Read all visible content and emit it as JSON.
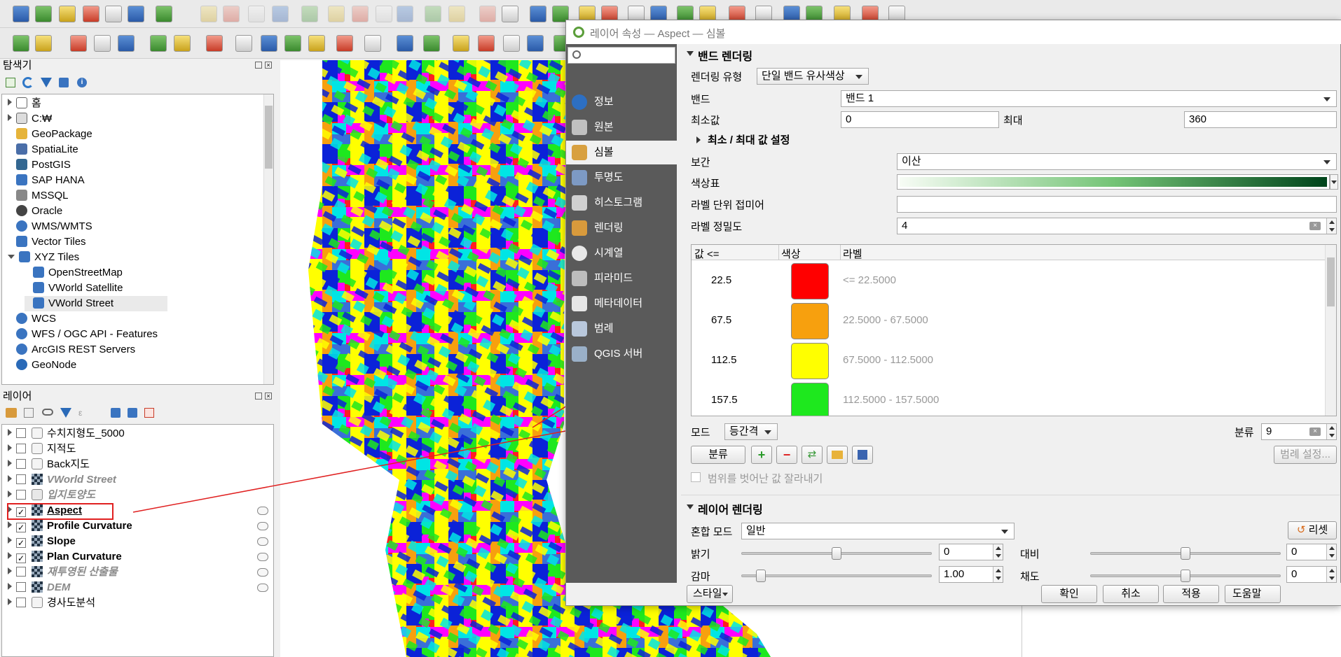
{
  "toolbar_top": {
    "colors": {
      "bg": "#eaeaea"
    }
  },
  "browser_panel": {
    "title": "탐색기",
    "items": [
      {
        "label": "홈",
        "expand": "closed",
        "icon": "home-icon",
        "indent": 0
      },
      {
        "label": "C:₩",
        "expand": "closed",
        "icon": "drive-icon",
        "indent": 0
      },
      {
        "label": "GeoPackage",
        "expand": "none",
        "icon": "geopackage-icon",
        "indent": 0
      },
      {
        "label": "SpatiaLite",
        "expand": "none",
        "icon": "spatialite-icon",
        "indent": 0
      },
      {
        "label": "PostGIS",
        "expand": "none",
        "icon": "postgis-icon",
        "indent": 0
      },
      {
        "label": "SAP HANA",
        "expand": "none",
        "icon": "sap-hana-icon",
        "indent": 0
      },
      {
        "label": "MSSQL",
        "expand": "none",
        "icon": "mssql-icon",
        "indent": 0
      },
      {
        "label": "Oracle",
        "expand": "none",
        "icon": "oracle-icon",
        "indent": 0
      },
      {
        "label": "WMS/WMTS",
        "expand": "none",
        "icon": "globe-icon",
        "indent": 0
      },
      {
        "label": "Vector Tiles",
        "expand": "none",
        "icon": "grid-icon",
        "indent": 0
      },
      {
        "label": "XYZ Tiles",
        "expand": "open",
        "icon": "grid-icon",
        "indent": 0
      },
      {
        "label": "OpenStreetMap",
        "expand": "none",
        "icon": "tiles-icon",
        "indent": 1
      },
      {
        "label": "VWorld Satellite",
        "expand": "none",
        "icon": "tiles-icon",
        "indent": 1
      },
      {
        "label": "VWorld Street",
        "expand": "none",
        "icon": "tiles-icon",
        "indent": 1
      },
      {
        "label": "WCS",
        "expand": "none",
        "icon": "globe-icon",
        "indent": 0
      },
      {
        "label": "WFS / OGC API - Features",
        "expand": "none",
        "icon": "globe-icon",
        "indent": 0
      },
      {
        "label": "ArcGIS REST Servers",
        "expand": "none",
        "icon": "globe-icon",
        "indent": 0
      },
      {
        "label": "GeoNode",
        "expand": "none",
        "icon": "geonode-icon",
        "indent": 0
      }
    ]
  },
  "layers_panel": {
    "title": "레이어",
    "items": [
      {
        "label": "수치지형도_5000",
        "checked": false,
        "bold": false,
        "italic": false,
        "icon": "group-icon"
      },
      {
        "label": "지적도",
        "checked": false,
        "bold": false,
        "italic": false,
        "icon": "group-icon"
      },
      {
        "label": "Back지도",
        "checked": false,
        "bold": false,
        "italic": false,
        "icon": "group-icon"
      },
      {
        "label": "VWorld Street",
        "checked": false,
        "bold": true,
        "italic": true,
        "icon": "raster-icon",
        "grey": true
      },
      {
        "label": "입지토양도",
        "checked": false,
        "bold": true,
        "italic": true,
        "icon": "polygon-icon",
        "grey": true
      },
      {
        "label": "Aspect",
        "checked": true,
        "bold": true,
        "italic": false,
        "icon": "raster-icon",
        "underline": true,
        "highlight": true
      },
      {
        "label": "Profile Curvature",
        "checked": true,
        "bold": true,
        "italic": false,
        "icon": "raster-icon"
      },
      {
        "label": "Slope",
        "checked": true,
        "bold": true,
        "italic": false,
        "icon": "raster-icon"
      },
      {
        "label": "Plan Curvature",
        "checked": true,
        "bold": true,
        "italic": false,
        "icon": "raster-icon"
      },
      {
        "label": "재투영된 산출물",
        "checked": false,
        "bold": true,
        "italic": true,
        "icon": "raster-icon",
        "grey": true
      },
      {
        "label": "DEM",
        "checked": false,
        "bold": true,
        "italic": true,
        "icon": "raster-icon",
        "grey": true
      },
      {
        "label": "경사도분석",
        "checked": false,
        "bold": false,
        "italic": false,
        "icon": "group-icon"
      }
    ]
  },
  "dialog": {
    "title": "레이어 속성 — Aspect — 심볼",
    "search_placeholder": "",
    "sidebar": [
      {
        "label": "정보",
        "icon": "info-icon",
        "color": "#2d6fc2"
      },
      {
        "label": "원본",
        "icon": "source-icon",
        "color": "#c0c0c0"
      },
      {
        "label": "심볼",
        "icon": "symbology-icon",
        "color": "#d8a040",
        "selected": true
      },
      {
        "label": "투명도",
        "icon": "transparency-icon",
        "color": "#7d9ac4"
      },
      {
        "label": "히스토그램",
        "icon": "histogram-icon",
        "color": "#d0d0d0"
      },
      {
        "label": "렌더링",
        "icon": "rendering-icon",
        "color": "#d89a3c"
      },
      {
        "label": "시계열",
        "icon": "clock-icon",
        "color": "#e8e8e8"
      },
      {
        "label": "피라미드",
        "icon": "pyramid-icon",
        "color": "#bdbdbd"
      },
      {
        "label": "메타데이터",
        "icon": "metadata-icon",
        "color": "#e6e6e6"
      },
      {
        "label": "범례",
        "icon": "legend-icon",
        "color": "#b9c8dc"
      },
      {
        "label": "QGIS 서버",
        "icon": "server-icon",
        "color": "#9ab0c8"
      }
    ],
    "band_rendering": {
      "section_title": "밴드 렌더링",
      "render_type_label": "렌더링 유형",
      "render_type_value": "단일 밴드 유사색상",
      "band_label": "밴드",
      "band_value": "밴드 1",
      "min_label": "최소값",
      "min_value": "0",
      "max_label": "최대",
      "max_value": "360",
      "minmax_section": "최소 / 최대 값 설정",
      "interp_label": "보간",
      "interp_value": "이산",
      "ramp_label": "색상표",
      "ramp_colors": [
        "#f7fcf5",
        "#74c476",
        "#00441b"
      ],
      "suffix_label": "라벨 단위 접미어",
      "suffix_value": "",
      "precision_label": "라벨 정밀도",
      "precision_value": "4",
      "table_headers": [
        "값 <=",
        "색상",
        "라벨"
      ],
      "table_rows": [
        {
          "value": "22.5",
          "color": "#ff0000",
          "label": "<= 22.5000"
        },
        {
          "value": "67.5",
          "color": "#f7a00e",
          "label": "22.5000 - 67.5000"
        },
        {
          "value": "112.5",
          "color": "#ffff00",
          "label": "67.5000 - 112.5000"
        },
        {
          "value": "157.5",
          "color": "#1ee81e",
          "label": "112.5000 - 157.5000"
        }
      ],
      "mode_label": "모드",
      "mode_value": "등간격",
      "classes_label": "분류",
      "classes_value": "9",
      "classify_button": "분류",
      "legend_settings_button": "범례 설정...",
      "clip_label": "범위를 벗어난 값 잘라내기"
    },
    "layer_rendering": {
      "section_title": "레이어 렌더링",
      "blend_label": "혼합 모드",
      "blend_value": "일반",
      "reset_button": "리셋",
      "brightness_label": "밝기",
      "brightness_value": "0",
      "contrast_label": "대비",
      "contrast_value": "0",
      "gamma_label": "감마",
      "gamma_value": "1.00",
      "saturation_label": "채도",
      "saturation_value": "0"
    },
    "footer": {
      "style_button": "스타일",
      "ok_button": "확인",
      "cancel_button": "취소",
      "apply_button": "적용",
      "help_button": "도움말"
    }
  },
  "colors": {
    "accent_red": "#e02020",
    "sidebar_bg": "#5a5a5a"
  }
}
